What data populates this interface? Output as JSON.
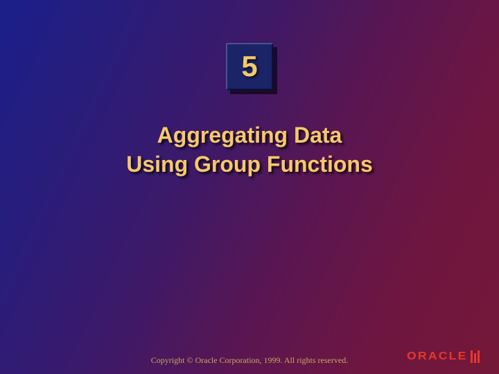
{
  "chapter": {
    "number": "5"
  },
  "title": {
    "line1": "Aggregating Data",
    "line2": "Using Group Functions"
  },
  "footer": {
    "copyright": "Copyright © Oracle Corporation, 1999. All rights reserved.",
    "logo_text": "ORACLE"
  }
}
